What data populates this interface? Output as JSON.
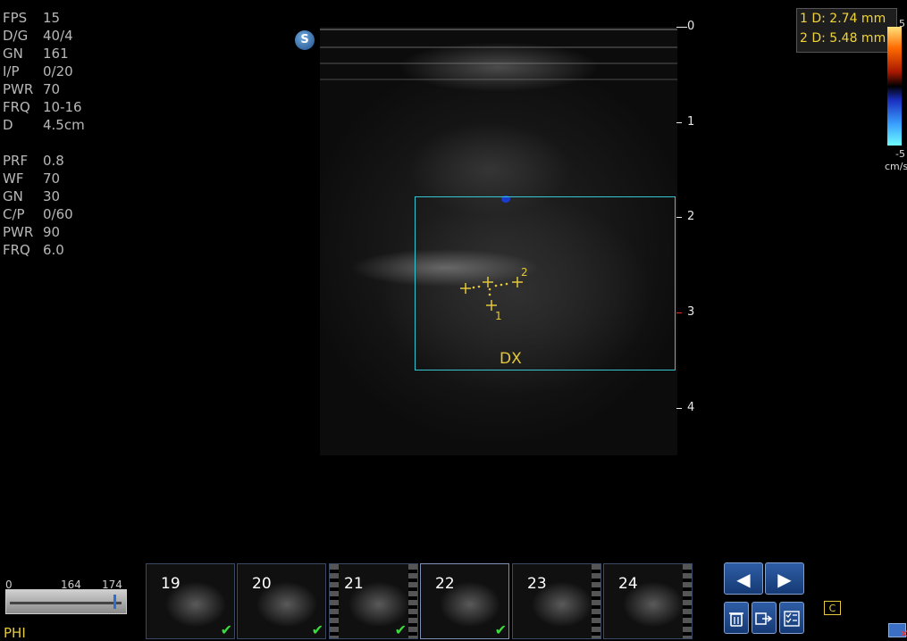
{
  "imaging_params": [
    {
      "key": "FPS",
      "value": "15"
    },
    {
      "key": "D/G",
      "value": "40/4"
    },
    {
      "key": "GN",
      "value": "161"
    },
    {
      "key": "I/P",
      "value": "0/20"
    },
    {
      "key": "PWR",
      "value": "70"
    },
    {
      "key": "FRQ",
      "value": "10-16"
    },
    {
      "key": "D",
      "value": "4.5cm"
    }
  ],
  "color_params": [
    {
      "key": "PRF",
      "value": "0.8"
    },
    {
      "key": "WF",
      "value": "70"
    },
    {
      "key": "GN",
      "value": "30"
    },
    {
      "key": "C/P",
      "value": "0/60"
    },
    {
      "key": "PWR",
      "value": "90"
    },
    {
      "key": "FRQ",
      "value": "6.0"
    }
  ],
  "measurements": [
    {
      "label": "1 D: 2.74  mm"
    },
    {
      "label": "2 D: 5.48  mm"
    }
  ],
  "depth_scale": [
    "0",
    "1",
    "2",
    "3",
    "4"
  ],
  "color_scale": {
    "top": "5",
    "bottom": "-5",
    "unit": "cm/s"
  },
  "roi_label": "DX",
  "caliper_labels": {
    "one": "1",
    "two": "2"
  },
  "phi": {
    "min": "0",
    "mid": "164",
    "max": "174",
    "label": "PHI"
  },
  "thumbnails": [
    {
      "number": "19",
      "checked": true
    },
    {
      "number": "20",
      "checked": true
    },
    {
      "number": "21",
      "checked": true
    },
    {
      "number": "22",
      "checked": true
    },
    {
      "number": "23",
      "checked": false
    },
    {
      "number": "24",
      "checked": false
    }
  ],
  "icons": {
    "logo": "S",
    "prev": "◀",
    "next": "▶",
    "delete": "trash-icon",
    "export": "export-icon",
    "checklist": "checklist-icon",
    "cine": "C"
  },
  "colors": {
    "accent": "#e6c93c",
    "roi": "#35c6d4",
    "check": "#3ddc3d"
  }
}
